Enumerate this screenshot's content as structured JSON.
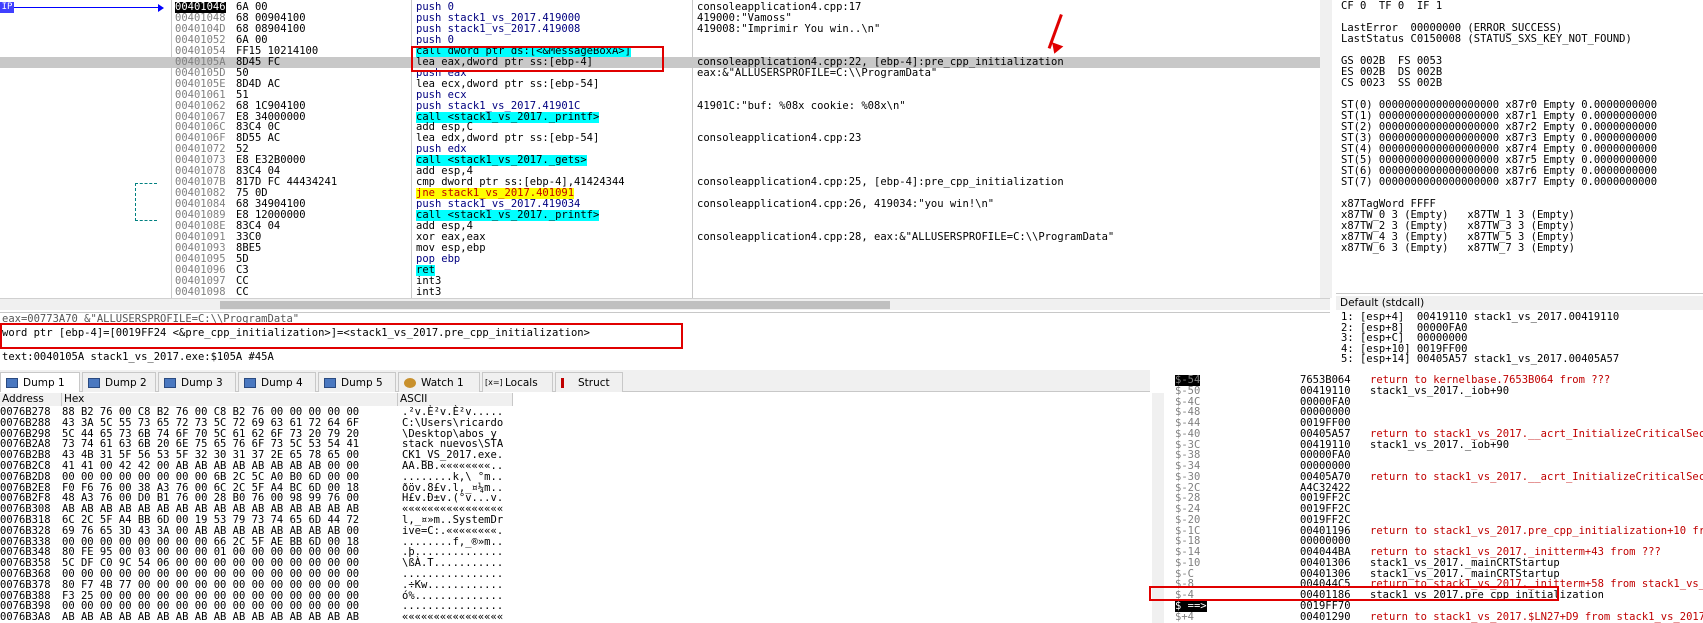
{
  "ip_label": "IP",
  "disasm": [
    {
      "addr": "00401046",
      "bytes": "6A 00",
      "instr": "push 0",
      "cmt": "consoleapplication4.cpp:17",
      "ip": true
    },
    {
      "addr": "00401048",
      "bytes": "68 00904100",
      "instr": "push stack1_vs_2017.419000",
      "cmt": "419000:\"Vamoss\""
    },
    {
      "addr": "0040104D",
      "bytes": "68 08904100",
      "instr": "push stack1_vs_2017.419008",
      "cmt": "419008:\"Imprimir You win..\\n\""
    },
    {
      "addr": "00401052",
      "bytes": "6A 00",
      "instr": "push 0",
      "cmt": ""
    },
    {
      "addr": "00401054",
      "bytes": "FF15 10214100",
      "instr": "call dword ptr ds:[<&MessageBoxA>]",
      "cmt": ""
    },
    {
      "addr": "0040105A",
      "bytes": "8D45 FC",
      "instr": "lea eax,dword ptr ss:[ebp-4]",
      "cmt": "consoleapplication4.cpp:22, [ebp-4]:pre_cpp_initialization",
      "hl": true
    },
    {
      "addr": "0040105D",
      "bytes": "50",
      "instr": "push eax",
      "cmt": "eax:&\"ALLUSERSPROFILE=C:\\\\ProgramData\""
    },
    {
      "addr": "0040105E",
      "bytes": "8D4D AC",
      "instr": "lea ecx,dword ptr ss:[ebp-54]",
      "cmt": ""
    },
    {
      "addr": "00401061",
      "bytes": "51",
      "instr": "push ecx",
      "cmt": ""
    },
    {
      "addr": "00401062",
      "bytes": "68 1C904100",
      "instr": "push stack1_vs_2017.41901C",
      "cmt": "41901C:\"buf: %08x cookie: %08x\\n\""
    },
    {
      "addr": "00401067",
      "bytes": "E8 34000000",
      "instr": "call <stack1_vs_2017._printf>",
      "cmt": ""
    },
    {
      "addr": "0040106C",
      "bytes": "83C4 0C",
      "instr": "add esp,C",
      "cmt": ""
    },
    {
      "addr": "0040106F",
      "bytes": "8D55 AC",
      "instr": "lea edx,dword ptr ss:[ebp-54]",
      "cmt": "consoleapplication4.cpp:23"
    },
    {
      "addr": "00401072",
      "bytes": "52",
      "instr": "push edx",
      "cmt": ""
    },
    {
      "addr": "00401073",
      "bytes": "E8 E32B0000",
      "instr": "call <stack1_vs_2017._gets>",
      "cmt": ""
    },
    {
      "addr": "00401078",
      "bytes": "83C4 04",
      "instr": "add esp,4",
      "cmt": ""
    },
    {
      "addr": "0040107B",
      "bytes": "817D FC 44434241",
      "instr": "cmp dword ptr ss:[ebp-4],41424344",
      "cmt": "consoleapplication4.cpp:25, [ebp-4]:pre_cpp_initialization"
    },
    {
      "addr": "00401082",
      "bytes": "75 0D",
      "instr": "jne stack1_vs_2017.401091",
      "cmt": ""
    },
    {
      "addr": "00401084",
      "bytes": "68 34904100",
      "instr": "push stack1_vs_2017.419034",
      "cmt": "consoleapplication4.cpp:26, 419034:\"you win!\\n\""
    },
    {
      "addr": "00401089",
      "bytes": "E8 12000000",
      "instr": "call <stack1_vs_2017._printf>",
      "cmt": ""
    },
    {
      "addr": "0040108E",
      "bytes": "83C4 04",
      "instr": "add esp,4",
      "cmt": ""
    },
    {
      "addr": "00401091",
      "bytes": "33C0",
      "instr": "xor eax,eax",
      "cmt": "consoleapplication4.cpp:28, eax:&\"ALLUSERSPROFILE=C:\\\\ProgramData\""
    },
    {
      "addr": "00401093",
      "bytes": "8BE5",
      "instr": "mov esp,ebp",
      "cmt": ""
    },
    {
      "addr": "00401095",
      "bytes": "5D",
      "instr": "pop ebp",
      "cmt": ""
    },
    {
      "addr": "00401096",
      "bytes": "C3",
      "instr": "ret",
      "cmt": ""
    },
    {
      "addr": "00401097",
      "bytes": "CC",
      "instr": "int3",
      "cmt": ""
    },
    {
      "addr": "00401098",
      "bytes": "CC",
      "instr": "int3",
      "cmt": ""
    }
  ],
  "regs": [
    "CF 0  TF 0  IF 1",
    "",
    "LastError  00000000 (ERROR_SUCCESS)",
    "LastStatus C0150008 (STATUS_SXS_KEY_NOT_FOUND)",
    "",
    "GS 002B  FS 0053",
    "ES 002B  DS 002B",
    "CS 0023  SS 002B",
    "",
    "ST(0) 0000000000000000000 x87r0 Empty 0.0000000000",
    "ST(1) 0000000000000000000 x87r1 Empty 0.0000000000",
    "ST(2) 0000000000000000000 x87r2 Empty 0.0000000000",
    "ST(3) 0000000000000000000 x87r3 Empty 0.0000000000",
    "ST(4) 0000000000000000000 x87r4 Empty 0.0000000000",
    "ST(5) 0000000000000000000 x87r5 Empty 0.0000000000",
    "ST(6) 0000000000000000000 x87r6 Empty 0.0000000000",
    "ST(7) 0000000000000000000 x87r7 Empty 0.0000000000",
    "",
    "x87TagWord FFFF",
    "x87TW_0 3 (Empty)   x87TW_1 3 (Empty)",
    "x87TW_2 3 (Empty)   x87TW_3 3 (Empty)",
    "x87TW_4 3 (Empty)   x87TW_5 3 (Empty)",
    "x87TW_6 3 (Empty)   x87TW_7 3 (Empty)"
  ],
  "callconv": "Default (stdcall)",
  "stackargs": [
    "1: [esp+4]  00419110 stack1_vs_2017.00419110",
    "2: [esp+8]  00000FA0",
    "3: [esp+C]  00000000",
    "4: [esp+10] 0019FF00",
    "5: [esp+14] 00405A57 stack1_vs_2017.00405A57"
  ],
  "info": {
    "line0": "eax=00773A70 &\"ALLUSERSPROFILE=C:\\\\ProgramData\"",
    "line1": "word ptr [ebp-4]=[0019FF24 <&pre_cpp_initialization>]=<stack1_vs_2017.pre_cpp_initialization>",
    "line2": "",
    "line3": "text:0040105A stack1_vs_2017.exe:$105A #45A"
  },
  "tabs": [
    {
      "label": "Dump 1",
      "active": true
    },
    {
      "label": "Dump 2"
    },
    {
      "label": "Dump 3"
    },
    {
      "label": "Dump 4"
    },
    {
      "label": "Dump 5"
    },
    {
      "label": "Watch 1"
    },
    {
      "label": "Locals",
      "prefix": "[x=]"
    },
    {
      "label": "Struct"
    }
  ],
  "dump_headers": {
    "address": "Address",
    "hex": "Hex",
    "ascii": "ASCII"
  },
  "dump": [
    {
      "a": "0076B278",
      "h": "88 B2 76 00 C8 B2 76 00 C8 B2 76 00 00 00 00 00",
      "c": ".²v.È²v.È²v....."
    },
    {
      "a": "0076B288",
      "h": "43 3A 5C 55 73 65 72 73 5C 72 69 63 61 72 64 6F",
      "c": "C:\\Users\\ricardo"
    },
    {
      "a": "0076B298",
      "h": "5C 44 65 73 6B 74 6F 70 5C 61 62 6F 73 20 79 20",
      "c": "\\Desktop\\abos y "
    },
    {
      "a": "0076B2A8",
      "h": "73 74 61 63 6B 20 6E 75 65 76 6F 73 5C 53 54 41",
      "c": "stack nuevos\\STA"
    },
    {
      "a": "0076B2B8",
      "h": "43 4B 31 5F 56 53 5F 32 30 31 37 2E 65 78 65 00",
      "c": "CK1_VS_2017.exe."
    },
    {
      "a": "0076B2C8",
      "h": "41 41 00 42 42 00 AB AB AB AB AB AB AB AB 00 00",
      "c": "AA.BB.««««««««.."
    },
    {
      "a": "0076B2D8",
      "h": "00 00 00 00 00 00 00 00 6B 2C 5C A0 B0 6D 00 00",
      "c": "........k,\\ °m.."
    },
    {
      "a": "0076B2E8",
      "h": "F0 F6 76 00 38 A3 76 00 6C 2C 5F A4 BC 6D 00 18",
      "c": "ðöv.8£v.l,_¤¼m.."
    },
    {
      "a": "0076B2F8",
      "h": "48 A3 76 00 D0 B1 76 00 28 B0 76 00 98 99 76 00",
      "c": "H£v.Ð±v.(°v...v."
    },
    {
      "a": "0076B308",
      "h": "AB AB AB AB AB AB AB AB AB AB AB AB AB AB AB AB",
      "c": "««««««««««««««««"
    },
    {
      "a": "0076B318",
      "h": "6C 2C 5F A4 BB 6D 00 19 53 79 73 74 65 6D 44 72",
      "c": "l,_¤»m..SystemDr"
    },
    {
      "a": "0076B328",
      "h": "69 76 65 3D 43 3A 00 AB AB AB AB AB AB AB AB 00",
      "c": "ive=C:.««««««««."
    },
    {
      "a": "0076B338",
      "h": "00 00 00 00 00 00 00 00 66 2C 5F AE BB 6D 00 18",
      "c": "........f,_®»m.."
    },
    {
      "a": "0076B348",
      "h": "80 FE 95 00 03 00 00 00 01 00 00 00 00 00 00 00",
      "c": ".þ.............."
    },
    {
      "a": "0076B358",
      "h": "5C DF C0 9C 54 06 00 00 00 00 00 00 00 00 00 00",
      "c": "\\ßÀ.T..........."
    },
    {
      "a": "0076B368",
      "h": "00 00 00 00 00 00 00 00 00 00 00 00 00 00 00 00",
      "c": "................"
    },
    {
      "a": "0076B378",
      "h": "80 F7 4B 77 00 00 00 00 00 00 00 00 00 00 00 00",
      "c": ".÷Kw............"
    },
    {
      "a": "0076B388",
      "h": "F3 25 00 00 00 00 00 00 00 00 00 00 00 00 00 00",
      "c": "ó%.............."
    },
    {
      "a": "0076B398",
      "h": "00 00 00 00 00 00 00 00 00 00 00 00 00 00 00 00",
      "c": "................"
    },
    {
      "a": "0076B3A8",
      "h": "AB AB AB AB AB AB AB AB AB AB AB AB AB AB AB AB",
      "c": "««««««««««««««««"
    }
  ],
  "stack": [
    {
      "o": "$-54",
      "v": "7653B064",
      "c": "return to kernelbase.7653B064 from ???",
      "ret": true,
      "top": true
    },
    {
      "o": "$-50",
      "v": "00419110",
      "c": "stack1_vs_2017._iob+90"
    },
    {
      "o": "$-4C",
      "v": "00000FA0",
      "c": ""
    },
    {
      "o": "$-48",
      "v": "00000000",
      "c": ""
    },
    {
      "o": "$-44",
      "v": "0019FF00",
      "c": ""
    },
    {
      "o": "$-40",
      "v": "00405A57",
      "c": "return to stack1_vs_2017.__acrt_InitializeCriticalSectionEx",
      "ret": true
    },
    {
      "o": "$-3C",
      "v": "00419110",
      "c": "stack1_vs_2017._iob+90"
    },
    {
      "o": "$-38",
      "v": "00000FA0",
      "c": ""
    },
    {
      "o": "$-34",
      "v": "00000000",
      "c": ""
    },
    {
      "o": "$-30",
      "v": "00405A70",
      "c": "return to stack1_vs_2017.__acrt_InitializeCriticalSectionEx",
      "ret": true
    },
    {
      "o": "$-2C",
      "v": "A4C32422",
      "c": ""
    },
    {
      "o": "$-28",
      "v": "0019FF2C",
      "c": ""
    },
    {
      "o": "$-24",
      "v": "0019FF2C",
      "c": ""
    },
    {
      "o": "$-20",
      "v": "0019FF2C",
      "c": ""
    },
    {
      "o": "$-1C",
      "v": "00401196",
      "c": "return to stack1_vs_2017.pre_cpp_initialization+10 from sta",
      "ret": true
    },
    {
      "o": "$-18",
      "v": "00000000",
      "c": ""
    },
    {
      "o": "$-14",
      "v": "004044BA",
      "c": "return to stack1_vs_2017._initterm+43 from ???",
      "ret": true
    },
    {
      "o": "$-10",
      "v": "00401306",
      "c": "stack1_vs_2017._mainCRTStartup"
    },
    {
      "o": "$-C",
      "v": "00401306",
      "c": "stack1_vs_2017._mainCRTStartup"
    },
    {
      "o": "$-8",
      "v": "004044C5",
      "c": "return to stack1_vs_2017._initterm+58 from stack1_vs_2017.@",
      "ret": true
    },
    {
      "o": "$-4",
      "v": "00401186",
      "c": "stack1_vs_2017.pre_cpp_initialization"
    },
    {
      "o": "$ ==>",
      "v": "0019FF70",
      "c": ""
    },
    {
      "o": "$+4",
      "v": "00401290",
      "c": "return to stack1_vs_2017.$LN27+D9 from stack1_vs_2017._main",
      "ret": true
    }
  ]
}
